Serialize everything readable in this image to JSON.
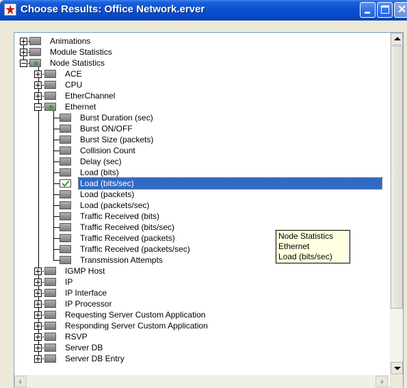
{
  "window": {
    "title": "Choose Results: Office Network.erver"
  },
  "tooltip": {
    "lines": [
      "Node Statistics",
      "Ethernet",
      "Load (bits/sec)"
    ]
  },
  "tree": {
    "top_level": [
      {
        "label": "Animations",
        "expanded": false,
        "state": "unchecked"
      },
      {
        "label": "Module Statistics",
        "expanded": false,
        "state": "unchecked"
      },
      {
        "label": "Node Statistics",
        "expanded": true,
        "state": "partial"
      }
    ],
    "node_statistics": [
      {
        "label": "ACE",
        "expanded": false,
        "state": "unchecked"
      },
      {
        "label": "CPU",
        "expanded": false,
        "state": "unchecked"
      },
      {
        "label": "EtherChannel",
        "expanded": false,
        "state": "unchecked"
      },
      {
        "label": "Ethernet",
        "expanded": true,
        "state": "partial"
      },
      {
        "label": "IGMP Host",
        "expanded": false,
        "state": "unchecked"
      },
      {
        "label": "IP",
        "expanded": false,
        "state": "unchecked"
      },
      {
        "label": "IP Interface",
        "expanded": false,
        "state": "unchecked"
      },
      {
        "label": "IP Processor",
        "expanded": false,
        "state": "unchecked"
      },
      {
        "label": "Requesting Server Custom Application",
        "expanded": false,
        "state": "unchecked"
      },
      {
        "label": "Responding Server Custom Application",
        "expanded": false,
        "state": "unchecked"
      },
      {
        "label": "RSVP",
        "expanded": false,
        "state": "unchecked"
      },
      {
        "label": "Server DB",
        "expanded": false,
        "state": "unchecked"
      },
      {
        "label": "Server DB Entry",
        "expanded": false,
        "state": "unchecked"
      }
    ],
    "ethernet": [
      {
        "label": "Burst Duration (sec)",
        "state": "unchecked"
      },
      {
        "label": "Burst ON/OFF",
        "state": "unchecked"
      },
      {
        "label": "Burst Size (packets)",
        "state": "unchecked"
      },
      {
        "label": "Collision Count",
        "state": "unchecked"
      },
      {
        "label": "Delay (sec)",
        "state": "unchecked"
      },
      {
        "label": "Load (bits)",
        "state": "unchecked"
      },
      {
        "label": "Load (bits/sec)",
        "state": "checked",
        "selected": true
      },
      {
        "label": "Load (packets)",
        "state": "unchecked"
      },
      {
        "label": "Load (packets/sec)",
        "state": "unchecked"
      },
      {
        "label": "Traffic Received (bits)",
        "state": "unchecked"
      },
      {
        "label": "Traffic Received (bits/sec)",
        "state": "unchecked"
      },
      {
        "label": "Traffic Received (packets)",
        "state": "unchecked"
      },
      {
        "label": "Traffic Received (packets/sec)",
        "state": "unchecked"
      },
      {
        "label": "Transmission Attempts",
        "state": "unchecked"
      }
    ]
  },
  "colors": {
    "selection": "#316ac5",
    "check": "#2f9e2f",
    "tooltip_bg": "#ffffe1"
  }
}
